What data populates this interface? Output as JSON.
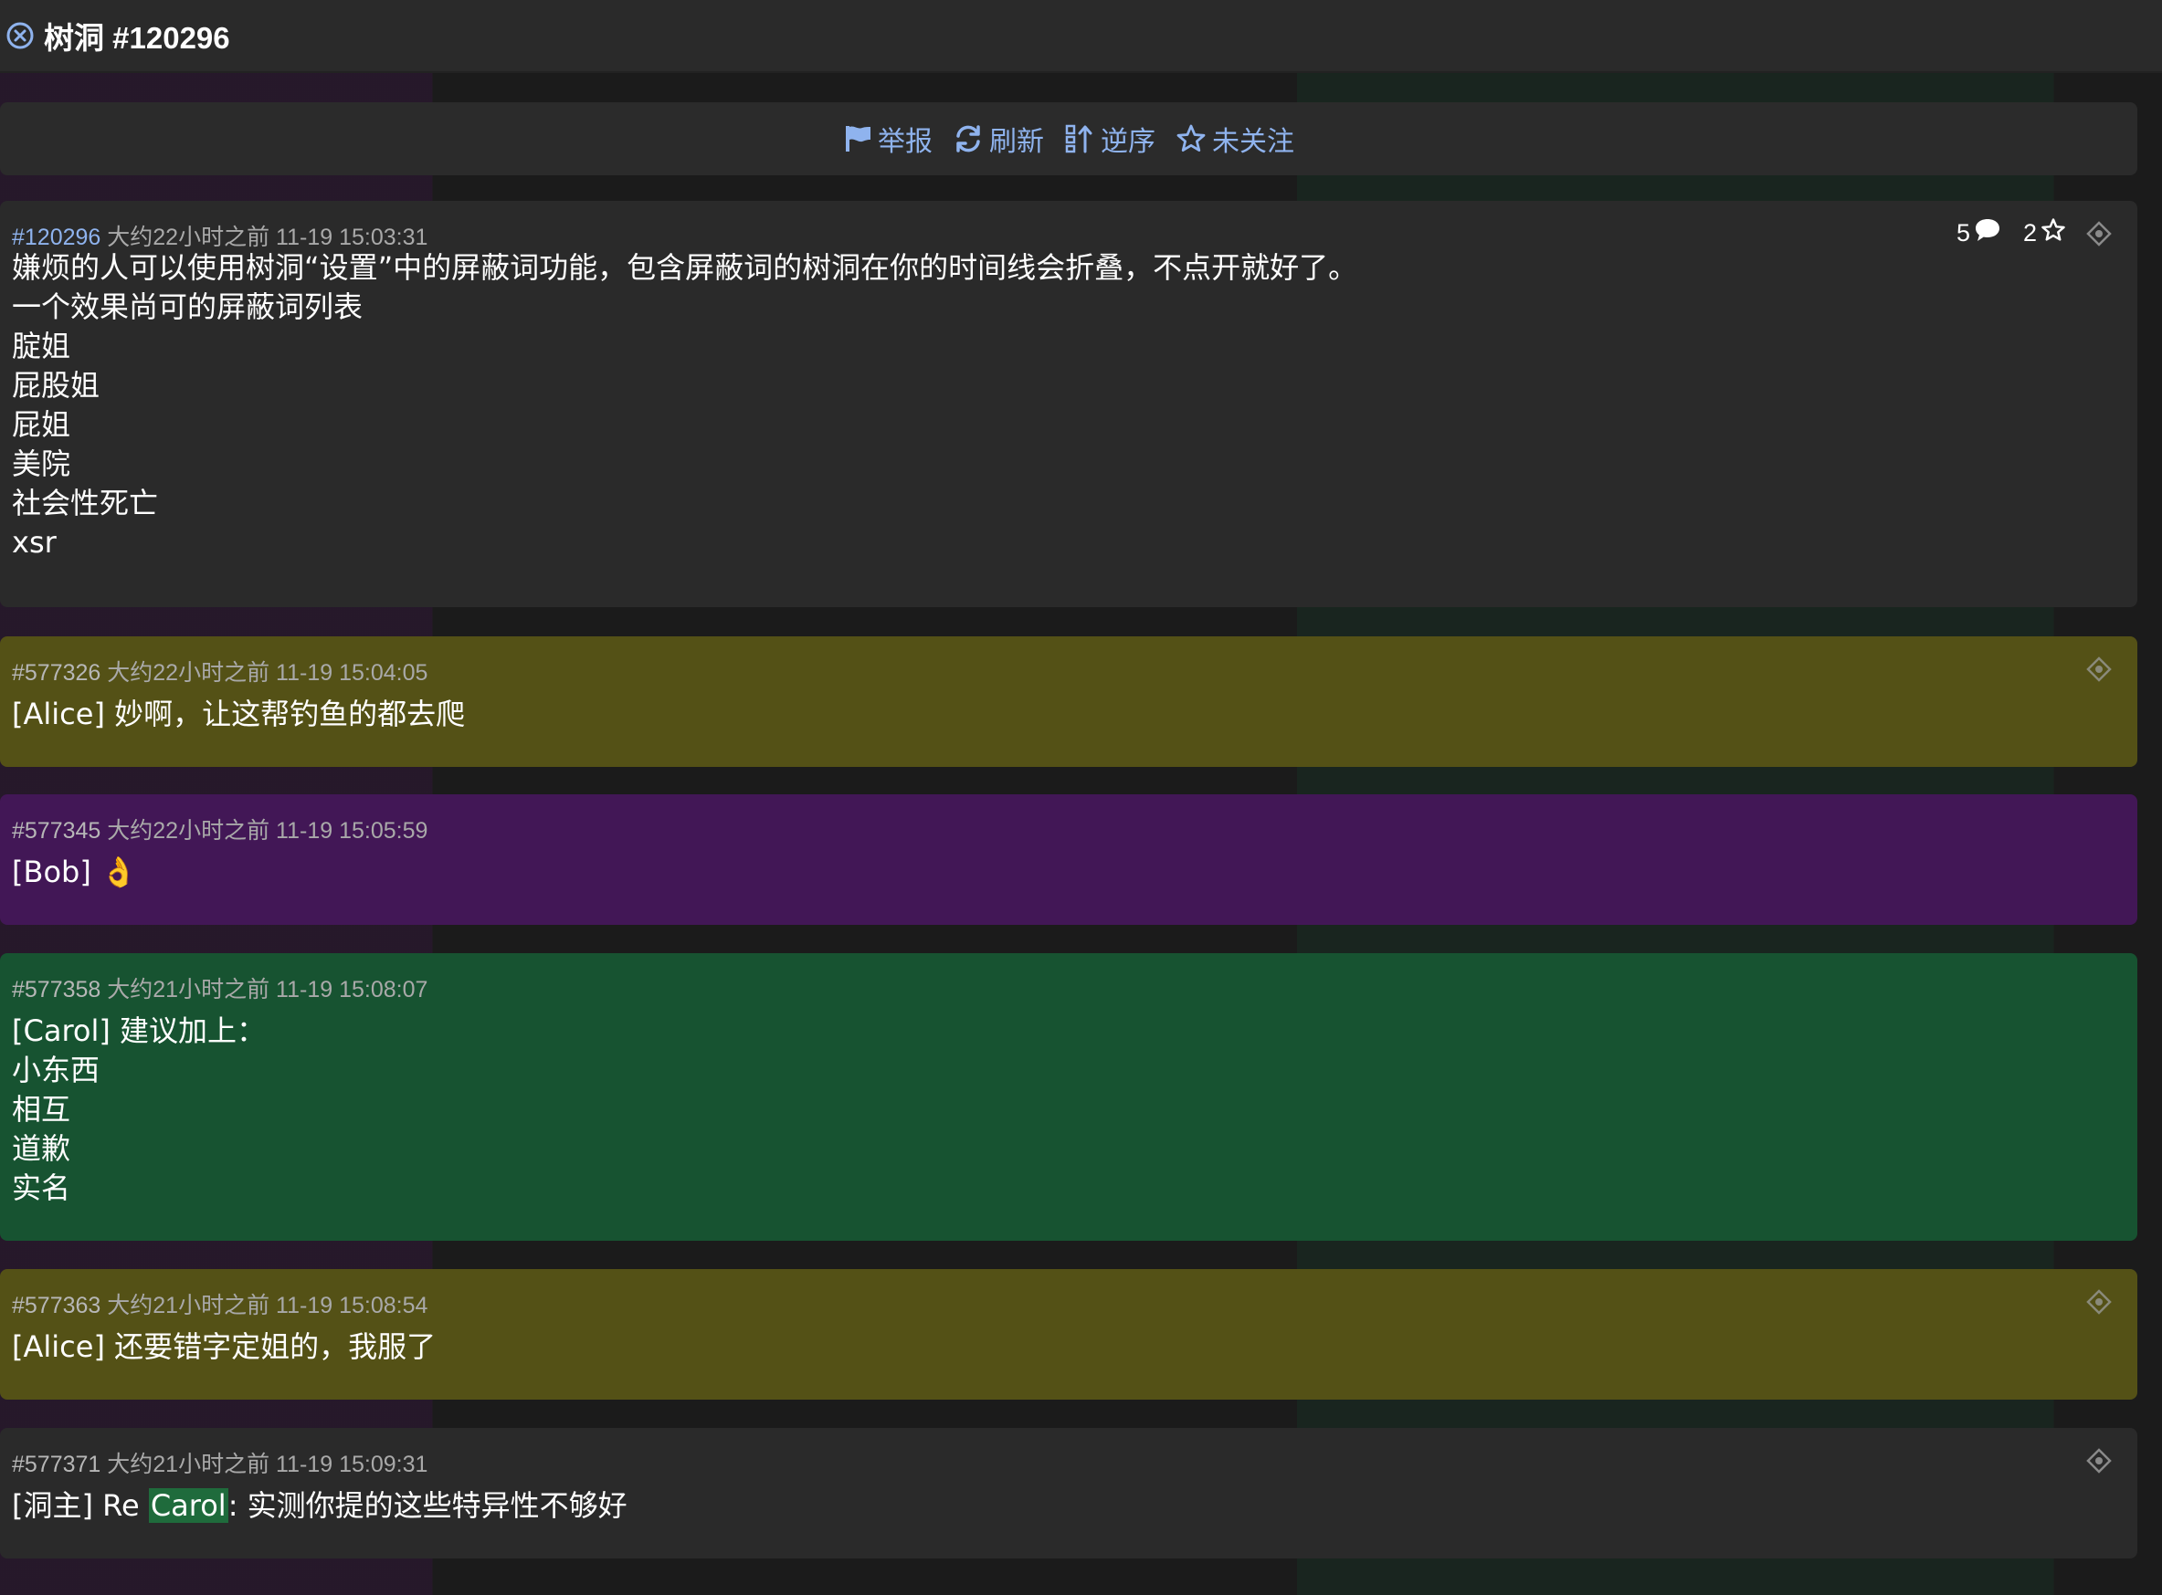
{
  "window": {
    "title": "树洞 #120296",
    "close_icon": "close-circle-icon"
  },
  "toolbar": {
    "report": "举报",
    "refresh": "刷新",
    "reverse": "逆序",
    "follow": "未关注",
    "accent": "#8fb3ee"
  },
  "post": {
    "id": "#120296",
    "relative_time": "大约22小时之前",
    "timestamp": "11-19 15:03:31",
    "reply_count": "5",
    "star_count": "2",
    "body": "嫌烦的人可以使用树洞“设置”中的屏蔽词功能，包含屏蔽词的树洞在你的时间线会折叠，不点开就好了。\n一个效果尚可的屏蔽词列表\n腚姐\n屁股姐\n屁姐\n美院\n社会性死亡\nxsr"
  },
  "replies": [
    {
      "id": "#577326",
      "relative_time": "大约22小时之前",
      "timestamp": "11-19 15:04:05",
      "body": "[Alice] 妙啊，让这帮钓鱼的都去爬",
      "color": "#545116"
    },
    {
      "id": "#577345",
      "relative_time": "大约22小时之前",
      "timestamp": "11-19 15:05:59",
      "body": "[Bob] 👌",
      "color": "#421756"
    },
    {
      "id": "#577358",
      "relative_time": "大约21小时之前",
      "timestamp": "11-19 15:08:07",
      "body": "[Carol] 建议加上：\n小东西\n相互\n道歉\n实名",
      "color": "#175331"
    },
    {
      "id": "#577363",
      "relative_time": "大约21小时之前",
      "timestamp": "11-19 15:08:54",
      "body": "[Alice] 还要错字定姐的，我服了",
      "color": "#545116"
    },
    {
      "id": "#577371",
      "relative_time": "大约21小时之前",
      "timestamp": "11-19 15:09:31",
      "body_prefix": "[洞主] Re ",
      "body_mention": "Carol",
      "body_suffix": ": 实测你提的这些特异性不够好",
      "color": "#2a2a2a"
    }
  ]
}
